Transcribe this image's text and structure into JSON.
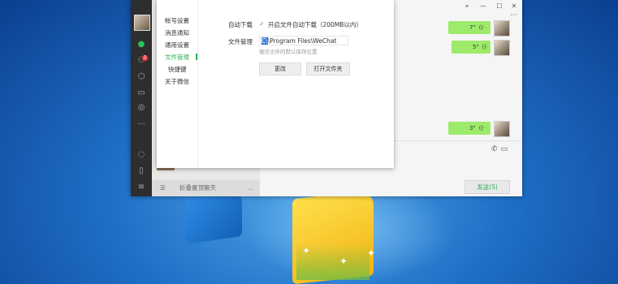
{
  "settings": {
    "nav": [
      "帐号设置",
      "消息通知",
      "通用设置",
      "文件管理",
      "快捷键",
      "关于微信"
    ],
    "active_index": 3,
    "auto_download_label": "自动下载",
    "auto_download_option": "开启文件自动下载（200MB以内）",
    "file_manage_label": "文件管理",
    "path_prefix": "C:",
    "path_rest": "\\Program Files\\WeChat",
    "hint": "微信文件的默认保存位置",
    "change_btn": "更改",
    "open_folder_btn": "打开文件夹"
  },
  "sidebar": {
    "badge": "2"
  },
  "chatlist": {
    "fold_label": "折叠置顶聊天"
  },
  "chat": {
    "window_controls": [
      "⌖",
      "—",
      "☐",
      "✕"
    ],
    "messages": [
      {
        "text": "7\"",
        "voice": "((·"
      },
      {
        "text": "5\"",
        "voice": "((·"
      },
      {
        "text": "3\"",
        "voice": "((·"
      }
    ],
    "send_label": "发送(S)"
  },
  "colors": {
    "accent": "#2bb155",
    "bubble": "#9eea6a",
    "sidebar": "#2e2e2e"
  }
}
